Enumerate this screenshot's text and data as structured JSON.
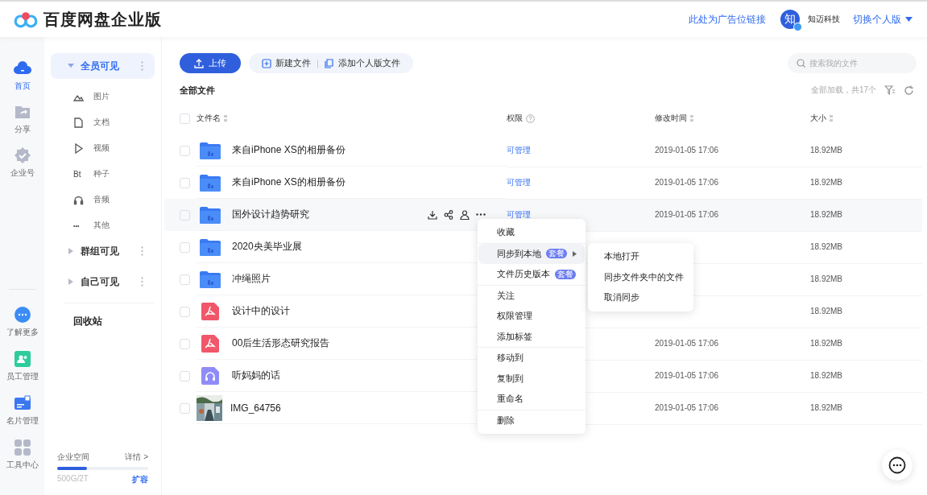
{
  "header": {
    "title": "百度网盘企业版",
    "ad_link": "此处为广告位链接",
    "avatar": "知",
    "company": "知迈科技",
    "switch": "切换个人版"
  },
  "rail": {
    "top": [
      {
        "label": "首页",
        "kind": "cloud",
        "selected": true
      },
      {
        "label": "分享",
        "kind": "share",
        "selected": false
      },
      {
        "label": "企业号",
        "kind": "badge",
        "selected": false
      }
    ],
    "bottom": [
      {
        "label": "了解更多",
        "kind": "chat",
        "selected": false
      },
      {
        "label": "员工管理",
        "kind": "people",
        "selected": false
      },
      {
        "label": "名片管理",
        "kind": "card",
        "selected": false
      },
      {
        "label": "工具中心",
        "kind": "grid",
        "selected": false
      }
    ]
  },
  "sidebar": {
    "groups": [
      {
        "label": "全员可见",
        "expanded": true,
        "selected": true,
        "children": [
          {
            "label": "图片"
          },
          {
            "label": "文档",
            "kind": "doc"
          },
          {
            "label": "视频",
            "kind": "video"
          },
          {
            "label": "种子",
            "kind": "bt",
            "glyph": "Bt"
          },
          {
            "label": "音频",
            "kind": "audio"
          },
          {
            "label": "其他",
            "kind": "more",
            "glyph": "•••"
          }
        ]
      },
      {
        "label": "群组可见",
        "expanded": false,
        "selected": false
      },
      {
        "label": "自己可见",
        "expanded": false,
        "selected": false
      }
    ],
    "trash": "回收站",
    "storage": {
      "label": "企业空间",
      "details": "详情 >",
      "level": 0.33,
      "usage": "500G/2T",
      "expand": "扩容"
    }
  },
  "toolbar": {
    "upload": "上传",
    "new_file": "新建文件",
    "add_personal": "添加个人版文件",
    "search": {
      "placeholder": "搜索我的文件"
    }
  },
  "breadcrumb": "全部文件",
  "load_status": "全部加载，共17个",
  "table": {
    "select_all_checked": false,
    "columns": [
      "文件名",
      "权限",
      "修改时间",
      "大小"
    ],
    "rows": [
      {
        "kind": "folder",
        "name": "来自iPhone XS的相册备份",
        "permission": "可管理",
        "modified": "2019-01-05 17:06",
        "size": "18.92MB",
        "hovered": false,
        "checked": false
      },
      {
        "kind": "folder",
        "name": "来自iPhone XS的相册备份",
        "permission": "可管理",
        "modified": "2019-01-05 17:06",
        "size": "18.92MB",
        "hovered": false,
        "checked": false
      },
      {
        "kind": "folder",
        "name": "国外设计趋势研究",
        "permission": "可管理",
        "modified": "2019-01-05 17:06",
        "size": "18.92MB",
        "hovered": true,
        "checked": false
      },
      {
        "kind": "folder",
        "name": "2020央美毕业展",
        "size": "18.92MB",
        "hovered": false,
        "checked": false
      },
      {
        "kind": "folder",
        "name": "冲绳照片",
        "size": "18.92MB",
        "hovered": false,
        "checked": false
      },
      {
        "kind": "pdf",
        "name": "设计中的设计",
        "size": "18.92MB",
        "hovered": false,
        "checked": false
      },
      {
        "kind": "pdf",
        "name": "00后生活形态研究报告",
        "modified": "2019-01-05 17:06",
        "size": "18.92MB",
        "hovered": false,
        "checked": false
      },
      {
        "kind": "audio",
        "name": "听妈妈的话",
        "modified": "2019-01-05 17:06",
        "size": "18.92MB",
        "hovered": false,
        "checked": false
      },
      {
        "kind": "picture",
        "name": "IMG_64756",
        "modified": "2019-01-05 17:06",
        "size": "18.92MB",
        "hovered": false,
        "checked": false
      }
    ]
  },
  "context_menu": {
    "groups": [
      [
        {
          "label": "收藏",
          "selected": false
        }
      ],
      [
        {
          "label": "同步到本地",
          "badge": "套餐",
          "submenu": true,
          "selected": true
        },
        {
          "label": "文件历史版本",
          "badge": "套餐",
          "selected": false
        }
      ],
      [
        {
          "label": "关注",
          "selected": false
        },
        {
          "label": "权限管理",
          "selected": false
        },
        {
          "label": "添加标签",
          "selected": false
        }
      ],
      [
        {
          "label": "移动到",
          "selected": false
        },
        {
          "label": "复制到",
          "selected": false
        },
        {
          "label": "重命名",
          "selected": false
        }
      ],
      [
        {
          "label": "删除",
          "selected": false
        }
      ]
    ],
    "submenu": [
      "本地打开",
      "同步文件夹中的文件",
      "取消同步"
    ]
  }
}
